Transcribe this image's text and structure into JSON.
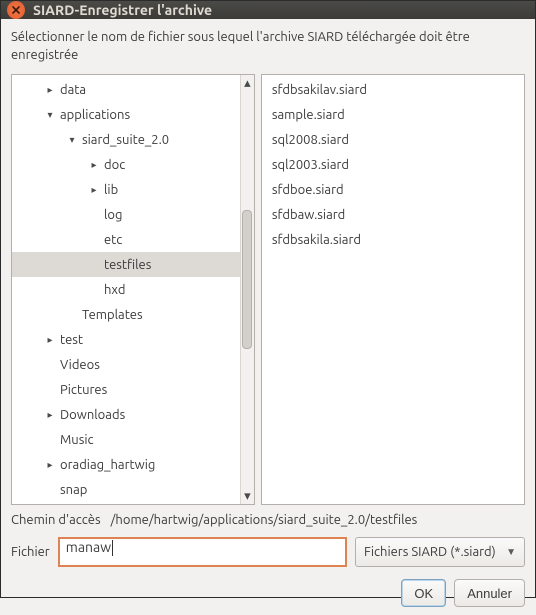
{
  "window": {
    "title": "SIARD-Enregistrer l'archive"
  },
  "instruction": "Sélectionner le nom de fichier sous lequel l'archive SIARD téléchargée doit être enregistrée",
  "tree": [
    {
      "label": "data",
      "depth": 1,
      "twisty": "right",
      "selected": false
    },
    {
      "label": "applications",
      "depth": 1,
      "twisty": "down",
      "selected": false
    },
    {
      "label": "siard_suite_2.0",
      "depth": 2,
      "twisty": "down",
      "selected": false
    },
    {
      "label": "doc",
      "depth": 3,
      "twisty": "right",
      "selected": false
    },
    {
      "label": "lib",
      "depth": 3,
      "twisty": "right",
      "selected": false
    },
    {
      "label": "log",
      "depth": 3,
      "twisty": "none",
      "selected": false
    },
    {
      "label": "etc",
      "depth": 3,
      "twisty": "none",
      "selected": false
    },
    {
      "label": "testfiles",
      "depth": 3,
      "twisty": "none",
      "selected": true
    },
    {
      "label": "hxd",
      "depth": 3,
      "twisty": "none",
      "selected": false
    },
    {
      "label": "Templates",
      "depth": 2,
      "twisty": "none",
      "selected": false
    },
    {
      "label": "test",
      "depth": 1,
      "twisty": "right",
      "selected": false
    },
    {
      "label": "Videos",
      "depth": 1,
      "twisty": "none",
      "selected": false
    },
    {
      "label": "Pictures",
      "depth": 1,
      "twisty": "none",
      "selected": false
    },
    {
      "label": "Downloads",
      "depth": 1,
      "twisty": "right",
      "selected": false
    },
    {
      "label": "Music",
      "depth": 1,
      "twisty": "none",
      "selected": false
    },
    {
      "label": "oradiag_hartwig",
      "depth": 1,
      "twisty": "right",
      "selected": false
    },
    {
      "label": "snap",
      "depth": 1,
      "twisty": "none",
      "selected": false
    }
  ],
  "files": [
    "sfdbsakilav.siard",
    "sample.siard",
    "sql2008.siard",
    "sql2003.siard",
    "sfdboe.siard",
    "sfdbaw.siard",
    "sfdbsakila.siard"
  ],
  "path": {
    "label": "Chemin d'accès",
    "value": "/home/hartwig/applications/siard_suite_2.0/testfiles"
  },
  "filename": {
    "label": "Fichier",
    "value": "manaw"
  },
  "filter": {
    "label": "Fichiers SIARD (*.siard)"
  },
  "buttons": {
    "ok": "OK",
    "cancel": "Annuler"
  }
}
